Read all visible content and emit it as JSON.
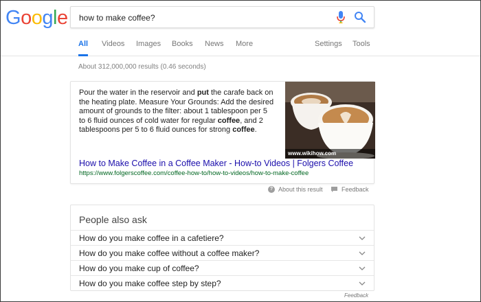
{
  "logo": {
    "letters": [
      "G",
      "o",
      "o",
      "g",
      "l",
      "e"
    ],
    "colors": [
      "#4285F4",
      "#EA4335",
      "#FBBC05",
      "#4285F4",
      "#34A853",
      "#EA4335"
    ]
  },
  "search": {
    "value": "how to make coffee?"
  },
  "icons": {
    "mic": "microphone-icon",
    "search": "search-icon",
    "help": "question-icon",
    "feedback": "feedback-flag-icon",
    "expand": "chevron-down-icon"
  },
  "tabs": [
    {
      "label": "All",
      "active": true
    },
    {
      "label": "Videos"
    },
    {
      "label": "Images"
    },
    {
      "label": "Books"
    },
    {
      "label": "News"
    },
    {
      "label": "More"
    },
    {
      "label": "Settings"
    },
    {
      "label": "Tools"
    }
  ],
  "result_stats": "About 312,000,000 results (0.46 seconds)",
  "featured_snippet": {
    "text_parts": [
      {
        "t": "Pour the water in the reservoir and ",
        "b": false
      },
      {
        "t": "put",
        "b": true
      },
      {
        "t": " the carafe back on the heating plate. Measure Your Grounds: Add the desired amount of grounds to the filter: about 1 tablespoon per 5 to 6 fluid ounces of cold water for regular ",
        "b": false
      },
      {
        "t": "coffee",
        "b": true
      },
      {
        "t": ", and 2 tablespoons per 5 to 6 fluid ounces for strong ",
        "b": false
      },
      {
        "t": "coffee",
        "b": true
      },
      {
        "t": ".",
        "b": false
      }
    ],
    "image_source": "www.wikihow.com",
    "link_title": "How to Make Coffee in a Coffee Maker - How-to Videos | Folgers Coffee",
    "url": "https://www.folgerscoffee.com/coffee-how-to/how-to-videos/how-to-make-coffee",
    "about_label": "About this result",
    "feedback_label": "Feedback"
  },
  "people_also_ask": {
    "title": "People also ask",
    "questions": [
      "How do you make coffee in a cafetiere?",
      "How do you make coffee without a coffee maker?",
      "How do you make cup of coffee?",
      "How do you make coffee step by step?"
    ],
    "feedback_label": "Feedback"
  }
}
